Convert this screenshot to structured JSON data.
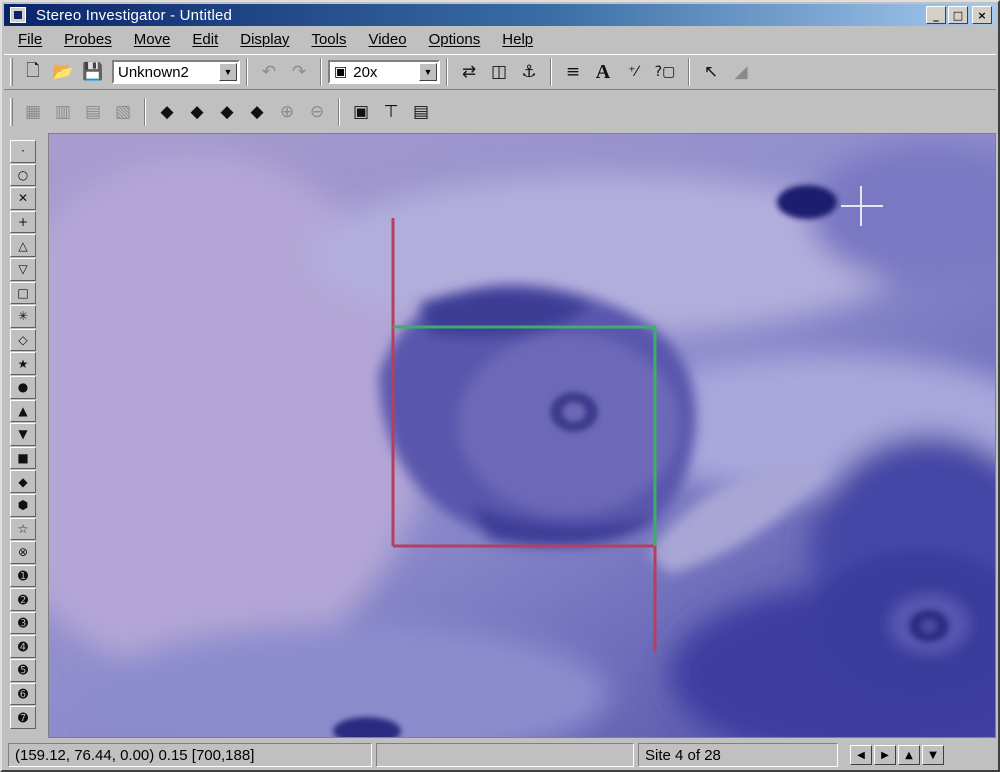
{
  "window": {
    "title": "Stereo Investigator - Untitled"
  },
  "title_controls": {
    "minimize_glyph": "_",
    "maximize_glyph": "□",
    "close_glyph": "×"
  },
  "menu": [
    {
      "label": "File"
    },
    {
      "label": "Probes"
    },
    {
      "label": "Move"
    },
    {
      "label": "Edit"
    },
    {
      "label": "Display"
    },
    {
      "label": "Tools"
    },
    {
      "label": "Video"
    },
    {
      "label": "Options"
    },
    {
      "label": "Help"
    }
  ],
  "toolbar": {
    "probe_select": {
      "value": "Unknown2"
    },
    "objective_select": {
      "value": "20x"
    },
    "icons": {
      "new_file_glyph": "🗋",
      "open_glyph": "📂",
      "save_glyph": "💾",
      "undo_glyph": "↶",
      "redo_glyph": "↷",
      "camera_glyph": "▣",
      "swap_glyph": "⇄",
      "cube_glyph": "◫",
      "stage_glyph": "⚓",
      "contour_glyph": "≡",
      "text_tool_glyph": "A",
      "measure_glyph": "⁺⁄",
      "help_glyph": "?▢",
      "pointer_glyph": "↖",
      "eraser_glyph": "◢",
      "video_glyph": "▦",
      "grid_glyph": "▥",
      "grid2_glyph": "▤",
      "frame_glyph": "▧",
      "nav_left_glyph": "◆",
      "nav_up_glyph": "◆",
      "nav_down_glyph": "◆",
      "nav_right_glyph": "◆",
      "zoom_in_glyph": "⊕",
      "zoom_out_glyph": "⊖",
      "view1_glyph": "▣",
      "view2_glyph": "⊤",
      "view3_glyph": "▤"
    }
  },
  "palette": [
    "·",
    "○",
    "✕",
    "+",
    "△",
    "▽",
    "□",
    "✳",
    "◇",
    "★",
    "●",
    "▲",
    "▼",
    "■",
    "◆",
    "⬢",
    "☆",
    "⊗",
    "➊",
    "➋",
    "➌",
    "➍",
    "➎",
    "➏",
    "➐"
  ],
  "status": {
    "coordinates": "(159.12, 76.44, 0.00) 0.15 [700,188]",
    "middle": "",
    "site": "Site 4 of 28",
    "nav_left": "◀",
    "nav_right": "▶",
    "nav_up": "▲",
    "nav_down": "▼"
  },
  "colors": {
    "titlebar": "#0a246a",
    "counting_frame_inclusion": "#3cae6a",
    "counting_frame_exclusion": "#b3405e",
    "crosshair": "#e6e6ee"
  }
}
